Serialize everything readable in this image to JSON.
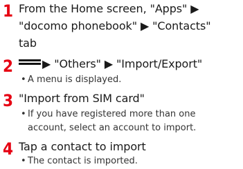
{
  "steps": [
    {
      "number": "1",
      "lines": [
        "From the Home screen, \"Apps\" ▶",
        "\"docomo phonebook\" ▶ \"Contacts\"",
        "tab"
      ]
    },
    {
      "number": "2",
      "title_after_icon": "▶ \"Others\" ▶ \"Import/Export\"",
      "icon": "menu-icon",
      "note": "A menu is displayed."
    },
    {
      "number": "3",
      "title": "\"Import from SIM card\"",
      "note_lines": [
        "If you have registered more than one",
        "account, select an account to import."
      ]
    },
    {
      "number": "4",
      "title": "Tap a contact to import",
      "note": "The contact is imported."
    }
  ],
  "bullet_char": "•",
  "colors": {
    "step_number": "#e60012",
    "text": "#1a1a1a"
  }
}
